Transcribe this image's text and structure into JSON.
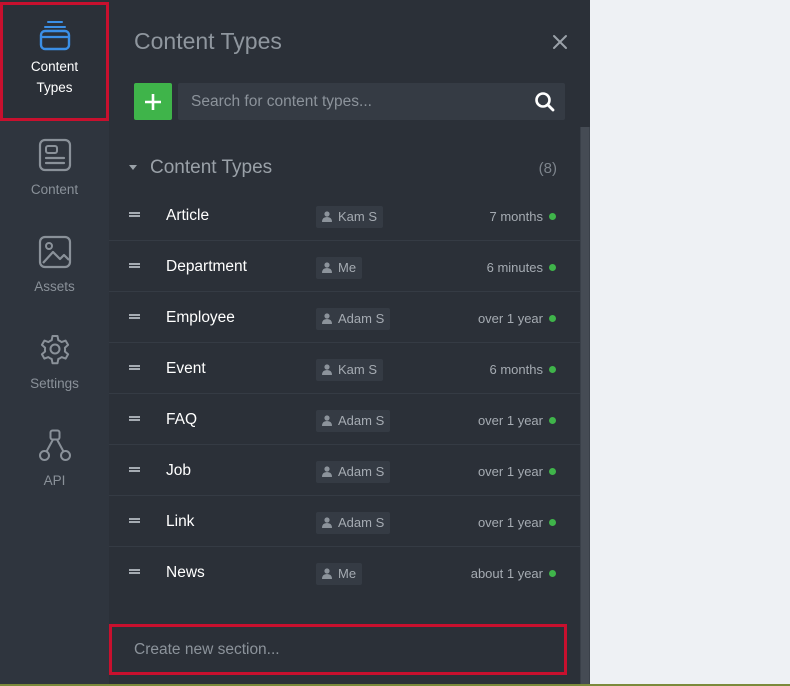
{
  "nav": {
    "items": [
      {
        "label": "Content\nTypes",
        "icon": "stack-icon"
      },
      {
        "label": "Content",
        "icon": "document-icon"
      },
      {
        "label": "Assets",
        "icon": "image-icon"
      },
      {
        "label": "Settings",
        "icon": "gear-icon"
      },
      {
        "label": "API",
        "icon": "api-icon"
      }
    ]
  },
  "panel": {
    "title": "Content Types",
    "search_placeholder": "Search for content types...",
    "section": {
      "title": "Content Types",
      "count": "(8)"
    },
    "rows": [
      {
        "name": "Article",
        "user": "Kam S",
        "time": "7 months"
      },
      {
        "name": "Department",
        "user": "Me",
        "time": "6 minutes"
      },
      {
        "name": "Employee",
        "user": "Adam S",
        "time": "over 1 year"
      },
      {
        "name": "Event",
        "user": "Kam S",
        "time": "6 months"
      },
      {
        "name": "FAQ",
        "user": "Adam S",
        "time": "over 1 year"
      },
      {
        "name": "Job",
        "user": "Adam S",
        "time": "over 1 year"
      },
      {
        "name": "Link",
        "user": "Adam S",
        "time": "over 1 year"
      },
      {
        "name": "News",
        "user": "Me",
        "time": "about 1 year"
      }
    ],
    "new_section_placeholder": "Create new section..."
  },
  "colors": {
    "accent_green": "#3fb44a",
    "highlight_red": "#c8102e",
    "nav_bg": "#2f353e",
    "panel_bg": "#2b3038"
  }
}
